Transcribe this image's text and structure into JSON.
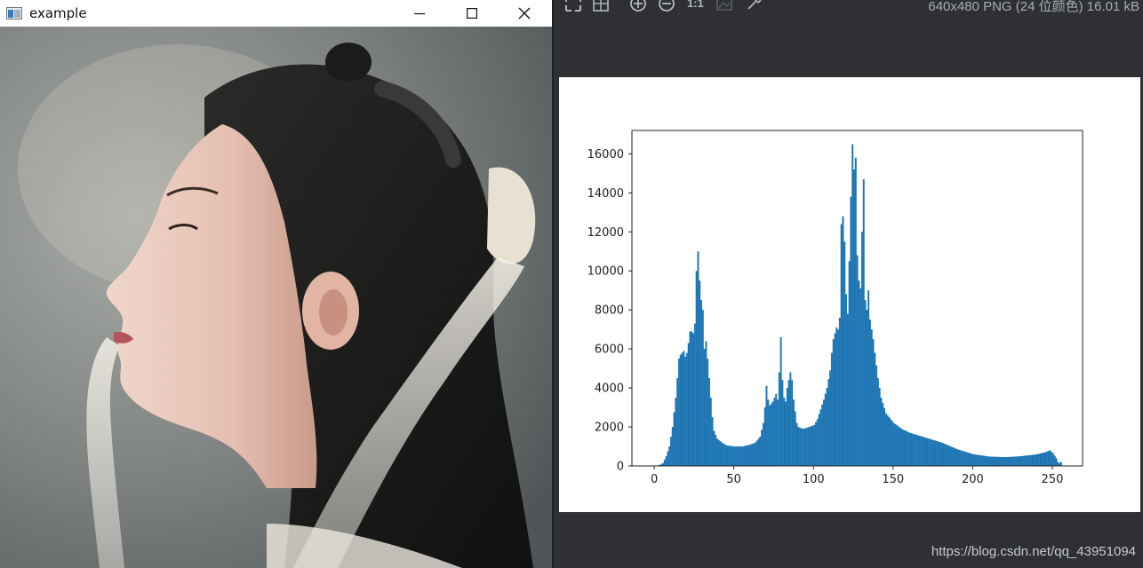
{
  "window": {
    "title": "example",
    "controls": [
      "minimize",
      "maximize",
      "close"
    ]
  },
  "photo": {
    "description_icon": "portrait-image"
  },
  "viewer": {
    "toolbar_icons": [
      "fit-icon",
      "grid-icon",
      "zoom-in-icon",
      "zoom-out-icon",
      "actual-size-icon",
      "image-icon",
      "eyedropper-icon"
    ],
    "actual_size_label": "1:1",
    "image_info": "640x480 PNG (24 位颜色) 16.01 kB",
    "watermark": "https://blog.csdn.net/qq_43951094"
  },
  "colors": {
    "bar": "#1f77b4",
    "viewer_bg": "#2e3034"
  },
  "chart_data": {
    "type": "bar",
    "title": "",
    "xlabel": "",
    "ylabel": "",
    "xlim": [
      -14,
      269
    ],
    "ylim": [
      0,
      17200
    ],
    "xticks": [
      0,
      50,
      100,
      150,
      200,
      250
    ],
    "yticks": [
      0,
      2000,
      4000,
      6000,
      8000,
      10000,
      12000,
      14000,
      16000
    ],
    "anchors": [
      [
        0,
        0
      ],
      [
        3,
        50
      ],
      [
        5,
        150
      ],
      [
        7,
        500
      ],
      [
        9,
        1000
      ],
      [
        11,
        2000
      ],
      [
        13,
        3500
      ],
      [
        14,
        4500
      ],
      [
        15,
        5500
      ],
      [
        16,
        5700
      ],
      [
        18,
        5900
      ],
      [
        19,
        5600
      ],
      [
        20,
        5800
      ],
      [
        21,
        6300
      ],
      [
        22,
        6900
      ],
      [
        23,
        6900
      ],
      [
        24,
        6800
      ],
      [
        25,
        7300
      ],
      [
        26,
        10000
      ],
      [
        27,
        11000
      ],
      [
        28,
        9500
      ],
      [
        29,
        8500
      ],
      [
        30,
        8000
      ],
      [
        31,
        6000
      ],
      [
        32,
        6400
      ],
      [
        33,
        5500
      ],
      [
        34,
        4500
      ],
      [
        35,
        3500
      ],
      [
        36,
        2500
      ],
      [
        37,
        1800
      ],
      [
        39,
        1400
      ],
      [
        42,
        1200
      ],
      [
        45,
        1050
      ],
      [
        50,
        1000
      ],
      [
        55,
        1000
      ],
      [
        60,
        1100
      ],
      [
        63,
        1200
      ],
      [
        66,
        1500
      ],
      [
        68,
        2200
      ],
      [
        69,
        3000
      ],
      [
        70,
        4100
      ],
      [
        71,
        3400
      ],
      [
        72,
        3100
      ],
      [
        74,
        3300
      ],
      [
        76,
        3700
      ],
      [
        77,
        3400
      ],
      [
        78,
        4800
      ],
      [
        79,
        6600
      ],
      [
        80,
        4400
      ],
      [
        81,
        3500
      ],
      [
        82,
        3300
      ],
      [
        83,
        4000
      ],
      [
        85,
        4800
      ],
      [
        86,
        4400
      ],
      [
        87,
        3400
      ],
      [
        88,
        2800
      ],
      [
        89,
        2200
      ],
      [
        90,
        2000
      ],
      [
        93,
        1900
      ],
      [
        97,
        2000
      ],
      [
        100,
        2100
      ],
      [
        102,
        2400
      ],
      [
        104,
        2900
      ],
      [
        106,
        3400
      ],
      [
        108,
        4000
      ],
      [
        110,
        4900
      ],
      [
        111,
        5800
      ],
      [
        112,
        6500
      ],
      [
        114,
        7100
      ],
      [
        115,
        7000
      ],
      [
        116,
        7600
      ],
      [
        117,
        12400
      ],
      [
        118,
        12800
      ],
      [
        119,
        11500
      ],
      [
        120,
        8800
      ],
      [
        121,
        7800
      ],
      [
        122,
        10500
      ],
      [
        123,
        13800
      ],
      [
        124,
        16500
      ],
      [
        125,
        15200
      ],
      [
        126,
        15800
      ],
      [
        127,
        10800
      ],
      [
        128,
        9500
      ],
      [
        129,
        9100
      ],
      [
        130,
        12000
      ],
      [
        131,
        14700
      ],
      [
        132,
        8500
      ],
      [
        133,
        8000
      ],
      [
        134,
        9000
      ],
      [
        135,
        7500
      ],
      [
        136,
        7000
      ],
      [
        137,
        6500
      ],
      [
        138,
        5800
      ],
      [
        140,
        4500
      ],
      [
        142,
        3500
      ],
      [
        145,
        2700
      ],
      [
        150,
        2200
      ],
      [
        155,
        1900
      ],
      [
        160,
        1700
      ],
      [
        170,
        1450
      ],
      [
        180,
        1200
      ],
      [
        190,
        850
      ],
      [
        200,
        600
      ],
      [
        210,
        480
      ],
      [
        220,
        450
      ],
      [
        230,
        500
      ],
      [
        240,
        600
      ],
      [
        245,
        700
      ],
      [
        248,
        800
      ],
      [
        250,
        650
      ],
      [
        252,
        400
      ],
      [
        253,
        200
      ],
      [
        254,
        150
      ],
      [
        255,
        200
      ]
    ]
  }
}
